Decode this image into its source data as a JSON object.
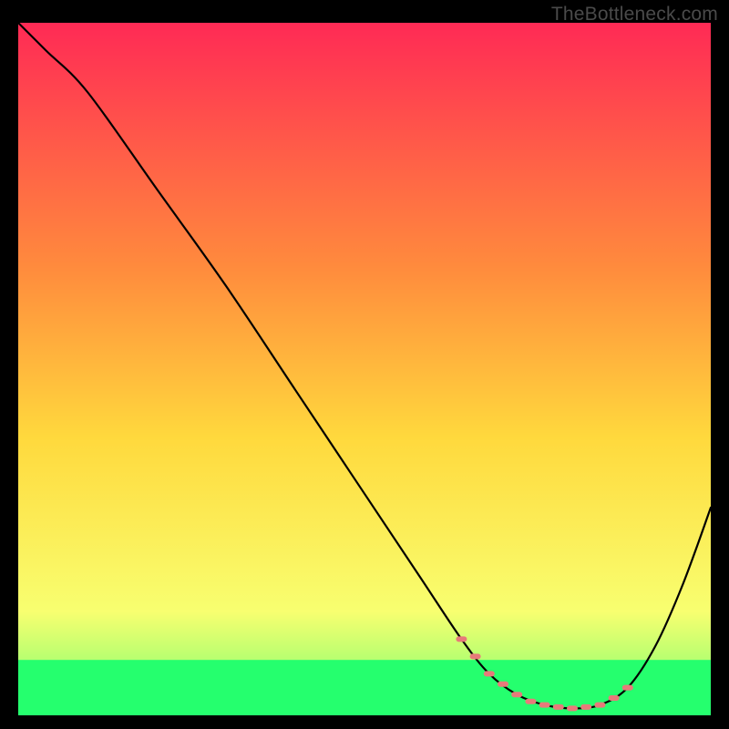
{
  "watermark": "TheBottleneck.com",
  "chart_data": {
    "type": "line",
    "title": "",
    "xlabel": "",
    "ylabel": "",
    "xlim": [
      0,
      100
    ],
    "ylim": [
      0,
      100
    ],
    "grid": false,
    "legend": false,
    "curve": {
      "name": "bottleneck-curve",
      "x": [
        0,
        4,
        10,
        20,
        30,
        40,
        50,
        58,
        64,
        68,
        72,
        76,
        80,
        84,
        88,
        92,
        96,
        100
      ],
      "y": [
        100,
        96,
        90,
        76,
        62,
        47,
        32,
        20,
        11,
        6,
        3,
        1.5,
        1,
        1.5,
        4,
        10,
        19,
        30
      ]
    },
    "sweet_spot_markers": {
      "name": "sweet-spot-dots",
      "color": "#e77a7a",
      "x": [
        64,
        66,
        68,
        70,
        72,
        74,
        76,
        78,
        80,
        82,
        84,
        86,
        88
      ],
      "y": [
        11,
        8.5,
        6,
        4.5,
        3,
        2,
        1.5,
        1.2,
        1,
        1.2,
        1.5,
        2.5,
        4
      ]
    },
    "bottom_band": {
      "present": true,
      "height_percent": 8
    },
    "background_gradient": {
      "stops": [
        {
          "offset": 0,
          "color": "#ff2a55"
        },
        {
          "offset": 35,
          "color": "#ff8a3d"
        },
        {
          "offset": 60,
          "color": "#ffd93d"
        },
        {
          "offset": 85,
          "color": "#f8ff70"
        },
        {
          "offset": 95,
          "color": "#9cff70"
        },
        {
          "offset": 100,
          "color": "#2bff7a"
        }
      ]
    }
  }
}
